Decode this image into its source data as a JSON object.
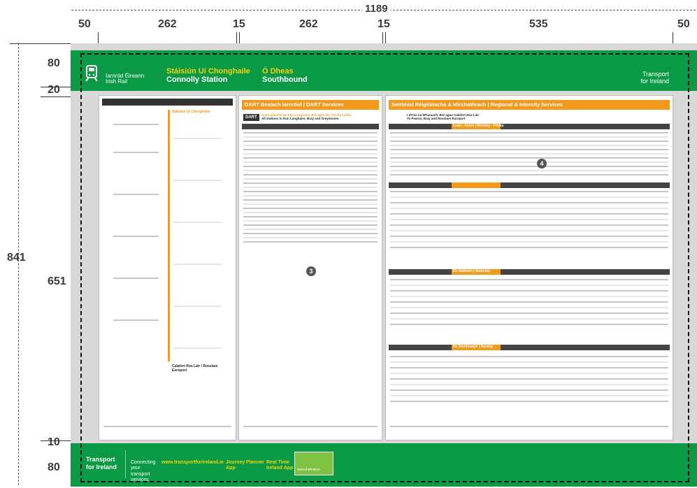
{
  "dimensions": {
    "total_width": "1189",
    "columns": [
      "50",
      "262",
      "15",
      "262",
      "15",
      "535",
      "50"
    ],
    "total_height": "841",
    "rows": [
      "80",
      "20",
      "651",
      "10",
      "80"
    ]
  },
  "banner": {
    "brand_ga": "Iarnród Éireann",
    "brand_en": "Irish Rail",
    "station_ga": "Stáisiún Uí Chonghaile",
    "station_en": "Connolly Station",
    "direction_ga": "Ó Dheas",
    "direction_en": "Southbound",
    "tfi_top": "Transport",
    "tfi_bottom": "for Ireland"
  },
  "panels": {
    "dart_title": "DART Bealach Iarnróid | DART Services",
    "dart_badge": "DART",
    "dart_sub_ga": "Gach stáisiún go Dún Laoghaire, Bré agus Na Clocha Liatha",
    "dart_sub_en": "All stations to Dun Laoghaire, Bray and Greystones",
    "regional_title": "Seirbhísí Réigiúnacha & Idirchathrach | Regional & Intercity Services",
    "regional_sub_ga": "I dTreo na bPiarsach, Bré agus Calafort Ros Láir",
    "regional_sub_en": "To Pearse, Bray and Rosslare Europort",
    "weekday_label": "Luan - Aoine | Monday - Friday",
    "saturday_label": "De Sathairn | Saturday",
    "sunday_label": "De Domhnaigh | Sunday",
    "route_from": "Stáisiún Uí Chonghaile",
    "route_to": "Calafort Ros Láir / Rosslare Europort"
  },
  "markers": [
    "3",
    "4"
  ],
  "footer": {
    "tfi_top": "Transport",
    "tfi_bottom": "for Ireland",
    "tagline": "Connecting your transport services",
    "contact": "www.transportforireland.ie",
    "journey_planner": "Journey Planner App",
    "real_time": "Real Time Ireland App",
    "web": "www.irishrail.ie"
  },
  "colors": {
    "green": "#0a9a46",
    "orange": "#f39a1d",
    "yellow": "#f7d20a",
    "dark": "#333333",
    "gray": "#d8d8d8"
  }
}
